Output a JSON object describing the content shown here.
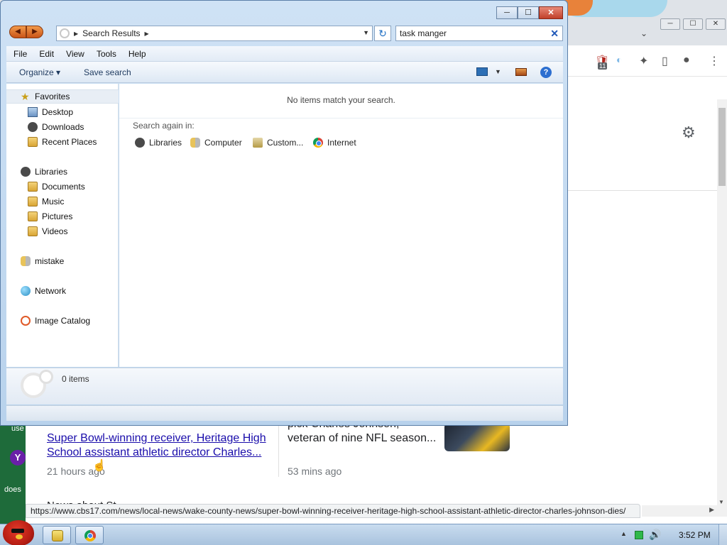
{
  "explorer": {
    "caption": {
      "minimize": "─",
      "maximize": "☐",
      "close": "✕"
    },
    "nav": {
      "back": "◀",
      "forward": "▶"
    },
    "address": {
      "arrow": "▶",
      "location": "Search Results",
      "arrow_end": "▶",
      "dropdown": "▼"
    },
    "refresh": "↻",
    "search": {
      "value": "task manger",
      "clear": "✕"
    },
    "menu": [
      "File",
      "Edit",
      "View",
      "Tools",
      "Help"
    ],
    "commands": {
      "organize": "Organize ▾",
      "save_search": "Save search",
      "view_dropdown": "▼",
      "help": "?"
    },
    "sidebar": {
      "favorites": {
        "label": "Favorites",
        "items": [
          "Desktop",
          "Downloads",
          "Recent Places"
        ]
      },
      "libraries": {
        "label": "Libraries",
        "items": [
          "Documents",
          "Music",
          "Pictures",
          "Videos"
        ]
      },
      "homegroup": "mistake",
      "network": "Network",
      "image_catalog": "Image Catalog"
    },
    "content": {
      "no_items": "No items match your search.",
      "search_again": "Search again in:",
      "locations": [
        "Libraries",
        "Computer",
        "Custom...",
        "Internet"
      ]
    },
    "details": {
      "count": "0 items"
    }
  },
  "browser": {
    "window_controls": {
      "minimize": "─",
      "maximize": "☐",
      "close": "✕"
    },
    "chevron": "⌄",
    "toolbar_icons": {
      "shield": "🛡",
      "badge": "11",
      "extensions": "✦",
      "sidepanel": "▯",
      "profile": "●",
      "menu": "⋮"
    },
    "settings_icon": "⚙",
    "left_strip": {
      "text1": "use",
      "yahoo": "Y",
      "text2": "does"
    },
    "news": [
      {
        "title": "Super Bowl-winning receiver, Heritage High School assistant athletic director Charles...",
        "time": "21 hours ago"
      },
      {
        "title": "pick Charles Johnson, veteran of nine NFL season...",
        "time": "53 mins ago"
      }
    ],
    "more_heading": "News about St...",
    "status_url": "https://www.cbs17.com/news/local-news/wake-county-news/super-bowl-winning-receiver-heritage-high-school-assistant-athletic-director-charles-johnson-dies/",
    "scroll_right": "▶",
    "scroll_down": "▼"
  },
  "taskbar": {
    "tray": {
      "show_hidden": "▲",
      "volume": "🔊",
      "clock": "3:52 PM"
    }
  }
}
